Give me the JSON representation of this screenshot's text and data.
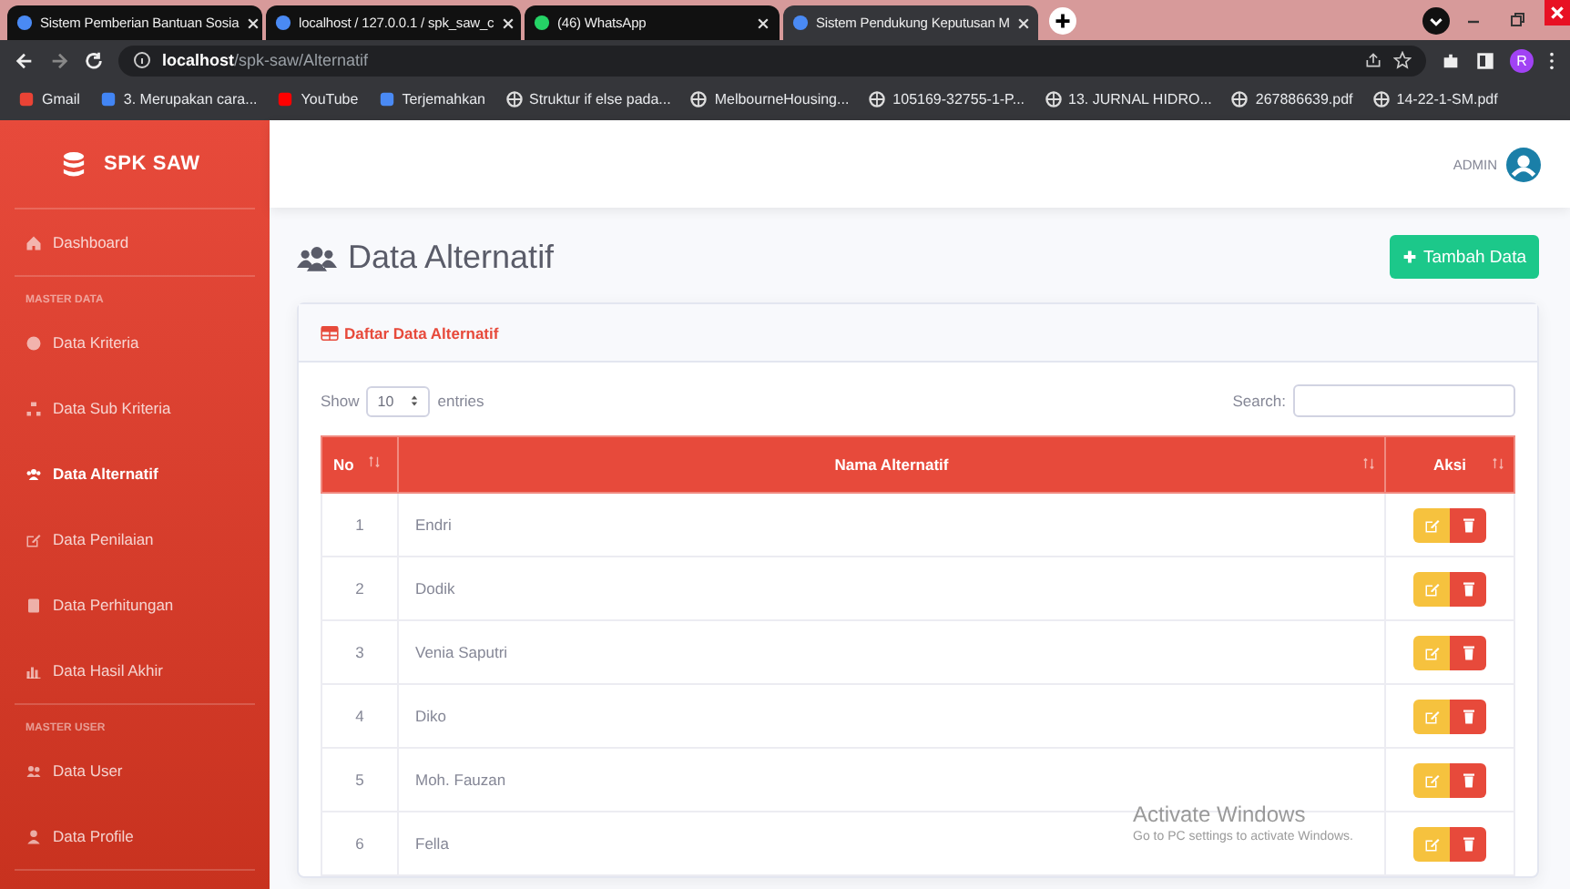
{
  "browser": {
    "tabs": [
      {
        "title": "Sistem Pemberian Bantuan Sosia",
        "selected": false
      },
      {
        "title": "localhost / 127.0.0.1 / spk_saw_c",
        "selected": false
      },
      {
        "title": "(46) WhatsApp",
        "selected": false
      },
      {
        "title": "Sistem Pendukung Keputusan M",
        "selected": true
      }
    ],
    "address": {
      "host": "localhost",
      "path": "/spk-saw/Alternatif"
    },
    "profile_initial": "R",
    "bookmarks": [
      "Gmail",
      "3. Merupakan cara...",
      "YouTube",
      "Terjemahkan",
      "Struktur if else pada...",
      "MelbourneHousing...",
      "105169-32755-1-P...",
      "13. JURNAL HIDRO...",
      "267886639.pdf",
      "14-22-1-SM.pdf"
    ]
  },
  "sidebar": {
    "brand": "SPK SAW",
    "items": [
      {
        "kind": "link",
        "label": "Dashboard",
        "selected": false
      },
      {
        "kind": "heading",
        "label": "MASTER DATA"
      },
      {
        "kind": "link",
        "label": "Data Kriteria",
        "selected": false
      },
      {
        "kind": "link",
        "label": "Data Sub Kriteria",
        "selected": false
      },
      {
        "kind": "link",
        "label": "Data Alternatif",
        "selected": true
      },
      {
        "kind": "link",
        "label": "Data Penilaian",
        "selected": false
      },
      {
        "kind": "link",
        "label": "Data Perhitungan",
        "selected": false
      },
      {
        "kind": "link",
        "label": "Data Hasil Akhir",
        "selected": false
      },
      {
        "kind": "heading",
        "label": "MASTER USER"
      },
      {
        "kind": "link",
        "label": "Data User",
        "selected": false
      },
      {
        "kind": "link",
        "label": "Data Profile",
        "selected": false
      }
    ]
  },
  "topbar": {
    "user": "ADMIN"
  },
  "page": {
    "title": "Data Alternatif",
    "add_button": "Tambah Data"
  },
  "card": {
    "title": "Daftar Data Alternatif",
    "show_label": "Show",
    "page_size": "10",
    "entries_label": "entries",
    "search_label": "Search:",
    "table": {
      "columns": [
        "No",
        "Nama Alternatif",
        "Aksi"
      ],
      "rows": [
        [
          "1",
          "Endri"
        ],
        [
          "2",
          "Dodik"
        ],
        [
          "3",
          "Venia Saputri"
        ],
        [
          "4",
          "Diko"
        ],
        [
          "5",
          "Moh. Fauzan"
        ],
        [
          "6",
          "Fella"
        ]
      ]
    }
  },
  "activation_notice": {
    "title": "Activate Windows",
    "subtitle": "Go to PC settings to activate Windows."
  }
}
